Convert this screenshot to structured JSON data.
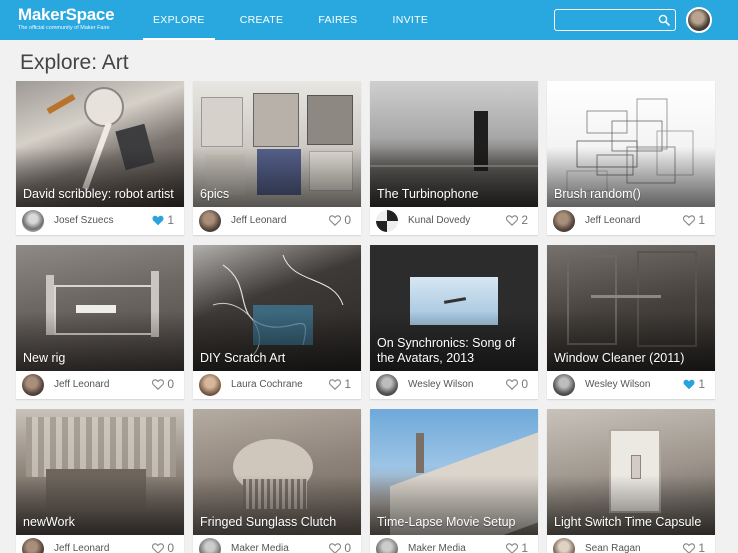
{
  "header": {
    "logo_title": "MakerSpace",
    "logo_subtitle": "The official community of Maker Faire",
    "nav": [
      {
        "label": "EXPLORE",
        "active": true
      },
      {
        "label": "CREATE",
        "active": false
      },
      {
        "label": "FAIRES",
        "active": false
      },
      {
        "label": "INVITE",
        "active": false
      }
    ],
    "search": {
      "value": "",
      "placeholder": ""
    },
    "accent_color": "#29a8e0"
  },
  "page_title": "Explore: Art",
  "cards": [
    {
      "title": "David scribbley: robot artist",
      "author": "Josef Szuecs",
      "likes": "1",
      "liked": true
    },
    {
      "title": "6pics",
      "author": "Jeff Leonard",
      "likes": "0",
      "liked": false
    },
    {
      "title": "The Turbinophone",
      "author": "Kunal Dovedy",
      "likes": "2",
      "liked": false
    },
    {
      "title": "Brush random()",
      "author": "Jeff Leonard",
      "likes": "1",
      "liked": false
    },
    {
      "title": "New rig",
      "author": "Jeff Leonard",
      "likes": "0",
      "liked": false
    },
    {
      "title": "DIY Scratch Art",
      "author": "Laura Cochrane",
      "likes": "1",
      "liked": false
    },
    {
      "title": "On Synchronics: Song of the Avatars, 2013",
      "author": "Wesley Wilson",
      "likes": "0",
      "liked": false
    },
    {
      "title": "Window Cleaner (2011)",
      "author": "Wesley Wilson",
      "likes": "1",
      "liked": true
    },
    {
      "title": "newWork",
      "author": "Jeff Leonard",
      "likes": "0",
      "liked": false
    },
    {
      "title": "Fringed Sunglass Clutch",
      "author": "Maker Media",
      "likes": "0",
      "liked": false
    },
    {
      "title": "Time-Lapse Movie Setup",
      "author": "Maker Media",
      "likes": "1",
      "liked": false
    },
    {
      "title": "Light Switch Time Capsule",
      "author": "Sean Ragan",
      "likes": "1",
      "liked": false
    }
  ],
  "icons": {
    "search": "search-icon",
    "heart": "heart-icon",
    "liked_color": "#2aa3dd",
    "unliked_color": "#888888"
  }
}
